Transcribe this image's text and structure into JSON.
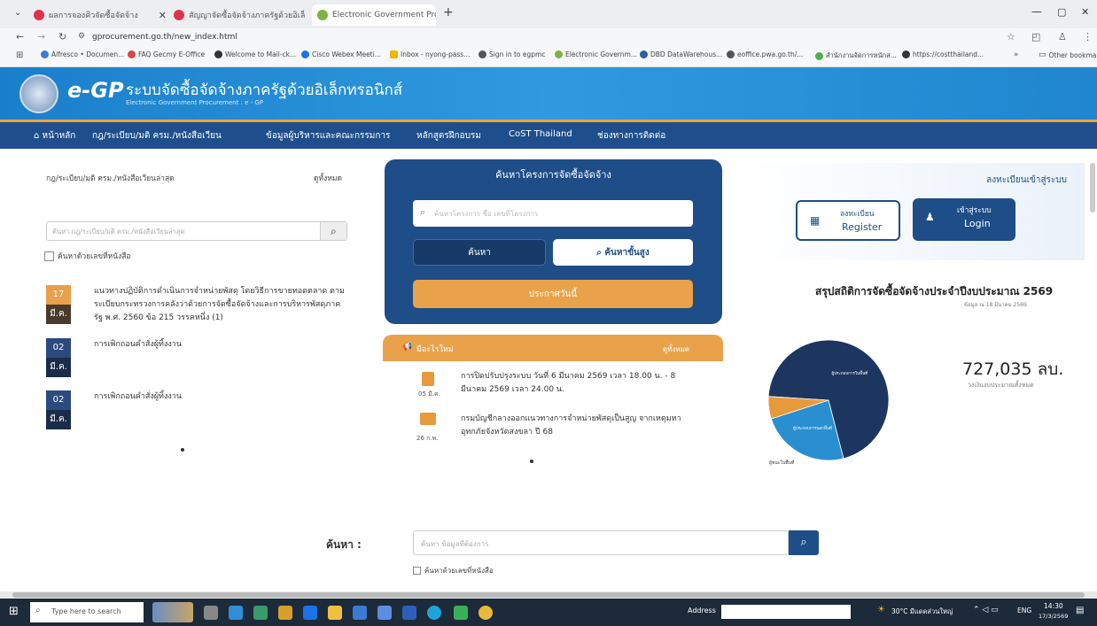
{
  "browser": {
    "tabs": [
      {
        "label": "ผลการจองคิวจัดซื้อจัดจ้าง",
        "color": "#e0334a"
      },
      {
        "label": "สัญญาจัดซื้อจัดจ้างภาครัฐด้วยอิเล็กทรอนิกส์",
        "color": "#e0334a"
      },
      {
        "label": "Electronic Government Procurement",
        "color": "#7cb342"
      }
    ],
    "new_tab": "+",
    "url": "gprocurement.go.th/new_index.html",
    "bookmarks": [
      "Alfresco • Documen...",
      "FAQ Gecmy E-Office",
      "Welcome to Mail-ck...",
      "Cisco Webex Meeti...",
      "Inbox - nyong-pass...",
      "Sign in to egpmc",
      "Electronic Governm...",
      "DBD DataWarehous...",
      "eoffice.pwa.go.th/...",
      "สำนักงานจัดการหนักส...",
      "https://costthailand..."
    ],
    "all_bookmarks": "Other bookmarks"
  },
  "site": {
    "logo_text": "e-GP",
    "title": "ระบบจัดซื้อจัดจ้างภาครัฐด้วยอิเล็กทรอนิกส์",
    "subtitle": "Electronic Government Procurement : e - GP",
    "nav": [
      "หน้าหลัก",
      "กฎ/ระเบียบ/มติ ครม./หนังสือเวียน",
      "ข้อมูลผู้บริหารและคณะกรรมการ",
      "หลักสูตรฝึกอบรม",
      "CoST Thailand",
      "ช่องทางการติดต่อ"
    ]
  },
  "left": {
    "heading": "กฎ/ระเบียบ/มติ ครม./หนังสือเวียนล่าสุด",
    "view_all": "ดูทั้งหมด",
    "search_placeholder": "ค้นหา กฎ/ระเบียบ/มติ ครม./หนังสือเวียนล่าสุด",
    "checkbox_label": "ค้นหาด้วยเลขที่หนังสือ",
    "items": [
      {
        "day": "17",
        "month": "มี.ค.",
        "text": "แนวทางปฏิบัติการดำเนินการจำหน่ายพัสดุ โดยวิธีการขายทอดตลาด ตามระเบียบกระทรวงการคลังว่าด้วยการจัดซื้อจัดจ้างและการบริหารพัสดุภาครัฐ พ.ศ. 2560 ข้อ 215 วรรคหนึ่ง (1)",
        "color": "#e8a04a"
      },
      {
        "day": "02",
        "month": "มี.ค.",
        "text": "การเพิกถอนคำสั่งผู้ทิ้งงาน",
        "color": "#2c4a7e"
      },
      {
        "day": "02",
        "month": "มี.ค.",
        "text": "การเพิกถอนคำสั่งผู้ทิ้งงาน",
        "color": "#2c4a7e"
      }
    ]
  },
  "center": {
    "panel_title": "ค้นหาโครงการจัดซื้อจัดจ้าง",
    "search_placeholder": "ค้นหาโครงการ ชื่อ เลขที่โครงการ",
    "search_btn": "ค้นหา",
    "advanced_btn": "ค้นหาขั้นสูง",
    "announce_btn": "ประกาศวันนี้",
    "news_header": "มีอะไรใหม่",
    "news_view_all": "ดูทั้งหมด",
    "news": [
      {
        "date": "05 มี.ค.",
        "text": "การปิดปรับปรุงระบบ วันที่ 6 มีนาคม 2569 เวลา 18.00 น. - 8 มีนาคม 2569 เวลา 24.00 น."
      },
      {
        "date": "26 ก.พ.",
        "text": "กรมบัญชีกลางออกแนวทางการจำหน่ายพัสดุเป็นสูญ จากเหตุมหาอุทกภัยจังหวัดสงขลา ปี 68"
      }
    ]
  },
  "right": {
    "login_heading": "ลงทะเบียนเข้าสู่ระบบ",
    "register_th": "ลงทะเบียน",
    "register_en": "Register",
    "login_th": "เข้าสู่ระบบ",
    "login_en": "Login",
    "stats_title": "สรุปสถิติการจัดซื้อจัดจ้างประจำปีงบประมาณ 2569",
    "stats_sub": "ข้อมูล ณ 18 มีนาคม 2569",
    "amount": "727,035 ลบ.",
    "amount_label": "วงเงินงบประมาณทั้งหมด",
    "pie_labels": [
      "ผู้ประกอบการในพื้นที่",
      "ผู้ประกอบการนอกพื้นที่",
      "ผู้ชนะในพื้นที่"
    ]
  },
  "bottom": {
    "label": "ค้นหา :",
    "placeholder": "ค้นหา ข้อมูลที่ต้องการ",
    "checkbox_label": "ค้นหาด้วยเลขที่หนังสือ"
  },
  "taskbar": {
    "search_placeholder": "Type here to search",
    "address_label": "Address",
    "weather": "30°C มีแดดส่วนใหญ่",
    "lang": "ENG",
    "time": "14:30",
    "date": "17/3/2569"
  },
  "chart_data": {
    "type": "pie",
    "categories": [
      "ผู้ประกอบการในพื้นที่",
      "ผู้ประกอบการนอกพื้นที่",
      "ผู้ชนะในพื้นที่"
    ],
    "values": [
      70,
      24,
      6
    ],
    "colors": [
      "#1c3660",
      "#2a8fd0",
      "#e79a3c"
    ]
  }
}
